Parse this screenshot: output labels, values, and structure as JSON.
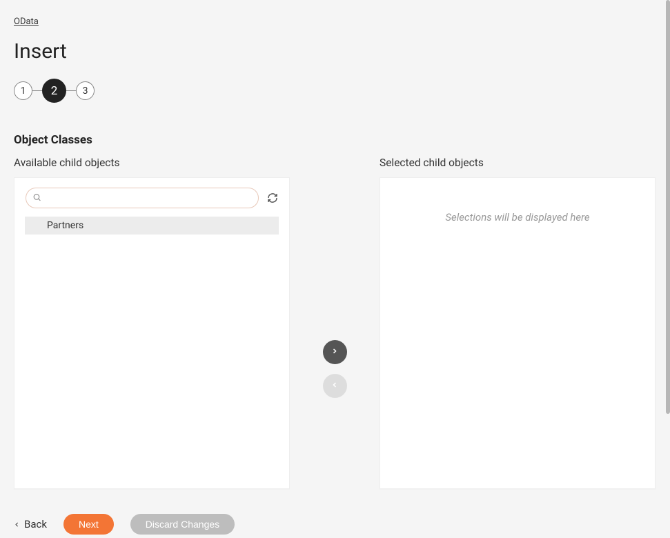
{
  "breadcrumb": "OData",
  "page_title": "Insert",
  "stepper": {
    "steps": [
      "1",
      "2",
      "3"
    ],
    "active_index": 1
  },
  "section_title": "Object Classes",
  "available": {
    "label": "Available child objects",
    "search_value": "",
    "items": [
      {
        "label": "Partners"
      }
    ]
  },
  "selected": {
    "label": "Selected child objects",
    "empty_text": "Selections will be displayed here"
  },
  "footer": {
    "back_label": "Back",
    "next_label": "Next",
    "discard_label": "Discard Changes"
  }
}
